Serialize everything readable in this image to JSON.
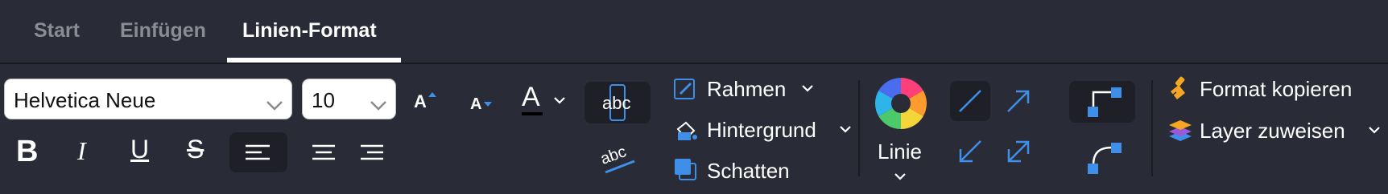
{
  "tabs": [
    {
      "label": "Start"
    },
    {
      "label": "Einfügen"
    },
    {
      "label": "Linien-Format"
    }
  ],
  "font": {
    "family": "Helvetica Neue",
    "size": "10"
  },
  "text_sample": "abc",
  "style_labels": {
    "bold": "B",
    "italic": "I",
    "underline": "U",
    "strike": "S",
    "font_color": "A"
  },
  "format": {
    "border": "Rahmen",
    "background": "Hintergrund",
    "shadow": "Schatten"
  },
  "line": {
    "label": "Linie"
  },
  "actions": {
    "copy_format": "Format kopieren",
    "assign_layer": "Layer zuweisen"
  },
  "colors": {
    "background": "#292b36",
    "accent": "#3f8ee8",
    "active_tab": "#ffffff",
    "inactive_tab": "#8a8c93"
  }
}
